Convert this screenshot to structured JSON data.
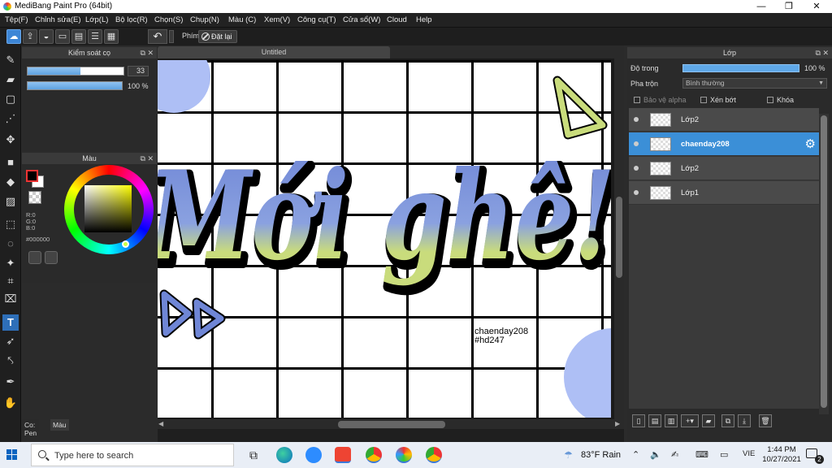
{
  "window": {
    "title": "MediBang Paint Pro (64bit)",
    "minimize": "—",
    "maximize": "❐",
    "close": "✕"
  },
  "menu": [
    "Tệp(F)",
    "Chỉnh sửa(E)",
    "Lớp(L)",
    "Bộ lọc(R)",
    "Chọn(S)",
    "Chụp(N)",
    "Màu (C)",
    "Xem(V)",
    "Công cụ(T)",
    "Cửa sổ(W)",
    "Cloud",
    "Help"
  ],
  "toolbar": {
    "keys_label": "Phím",
    "restore_label": "Đặt lại"
  },
  "brush_panel": {
    "title": "Kiểm soát cọ",
    "size_value": "33",
    "size_fraction": 0.55,
    "opacity_value": "100 %",
    "opacity_fraction": 1.0
  },
  "color_panel": {
    "title": "Màu",
    "r": "R:0",
    "g": "G:0",
    "b": "B:0",
    "hex": "#000000"
  },
  "toolbox_tabs": {
    "pen": "Co: Pen",
    "color": "Màu"
  },
  "document": {
    "tab_title": "Untitled"
  },
  "artwork": {
    "main_text": "Mới ghê!",
    "signature_line1": "chaenday208",
    "signature_line2": "#hd247"
  },
  "layer_panel": {
    "title": "Lớp",
    "opacity_label": "Độ trong",
    "opacity_value": "100 %",
    "blend_label": "Pha trộn",
    "blend_value": "Bình thường",
    "protect_alpha": "Bảo vệ alpha",
    "clipping": "Xén bớt",
    "lock": "Khóa",
    "layers": [
      {
        "name": "Lớp2",
        "selected": false
      },
      {
        "name": "chaenday208",
        "selected": true
      },
      {
        "name": "Lớp2",
        "selected": false
      },
      {
        "name": "Lớp1",
        "selected": false
      }
    ]
  },
  "taskbar": {
    "search_placeholder": "Type here to search",
    "weather": "83°F  Rain",
    "language": "VIE",
    "time": "1:44 PM",
    "date": "10/27/2021",
    "notifications": "2"
  },
  "colors": {
    "accent": "#3b8fd7",
    "lettering_top": "#6f86d6",
    "lettering_bottom": "#c9dc7c"
  }
}
